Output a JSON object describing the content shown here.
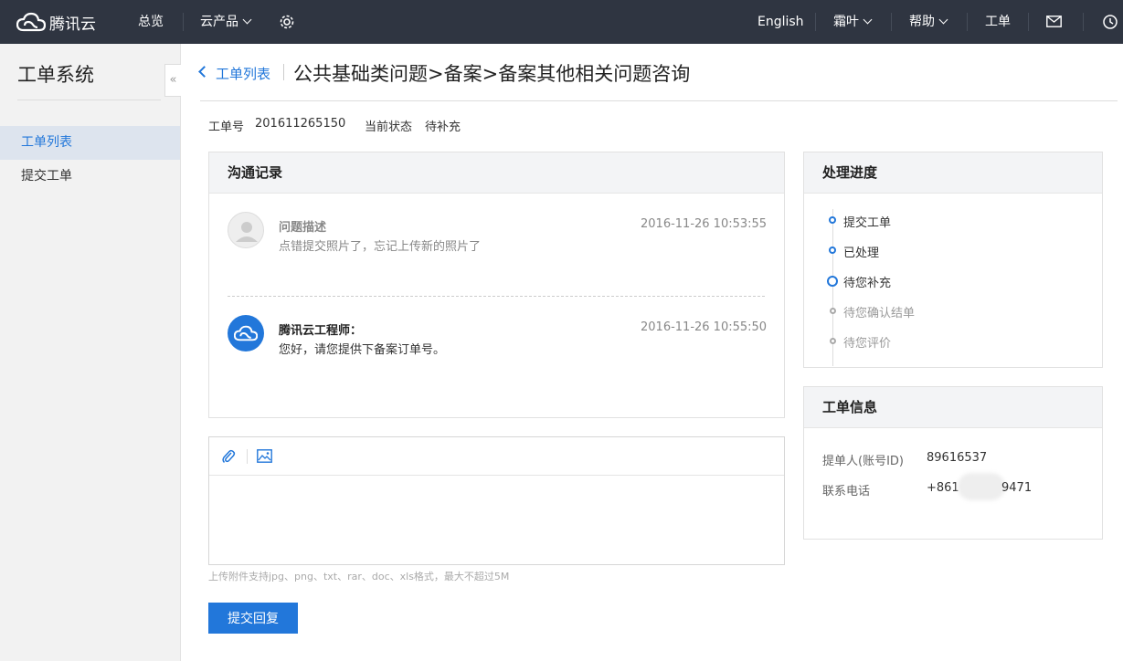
{
  "topbar": {
    "logo_text": "腾讯云",
    "overview": "总览",
    "products": "云产品",
    "lang": "English",
    "user": "霜叶",
    "help": "帮助",
    "ticket": "工单"
  },
  "sidebar": {
    "title": "工单系统",
    "collapse": "«",
    "items": [
      {
        "label": "工单列表"
      },
      {
        "label": "提交工单"
      }
    ]
  },
  "header": {
    "back_link": "工单列表",
    "title": "公共基础类问题>备案>备案其他相关问题咨询"
  },
  "meta": {
    "id_label": "工单号",
    "id_value": "201611265150",
    "status_label": "当前状态",
    "status_value": "待补充"
  },
  "communication": {
    "title": "沟通记录",
    "messages": [
      {
        "name": "问题描述",
        "text": "点错提交照片了，忘记上传新的照片了",
        "time": "2016-11-26 10:53:55"
      },
      {
        "name": "腾讯云工程师：",
        "text": "您好，请您提供下备案订单号。",
        "time": "2016-11-26 10:55:50"
      }
    ]
  },
  "progress": {
    "title": "处理进度",
    "steps": [
      {
        "label": "提交工单"
      },
      {
        "label": "已处理"
      },
      {
        "label": "待您补充"
      },
      {
        "label": "待您确认结单"
      },
      {
        "label": "待您评价"
      }
    ]
  },
  "info": {
    "title": "工单信息",
    "submitter_label": "提单人(账号ID)",
    "submitter_value": "89616537",
    "phone_label": "联系电话",
    "phone_prefix": "+861",
    "phone_suffix": "9471"
  },
  "reply": {
    "hint": "上传附件支持jpg、png、txt、rar、doc、xls格式，最大不超过5M",
    "submit_label": "提交回复"
  },
  "colors": {
    "accent": "#2277da",
    "topbar": "#2f3541"
  }
}
